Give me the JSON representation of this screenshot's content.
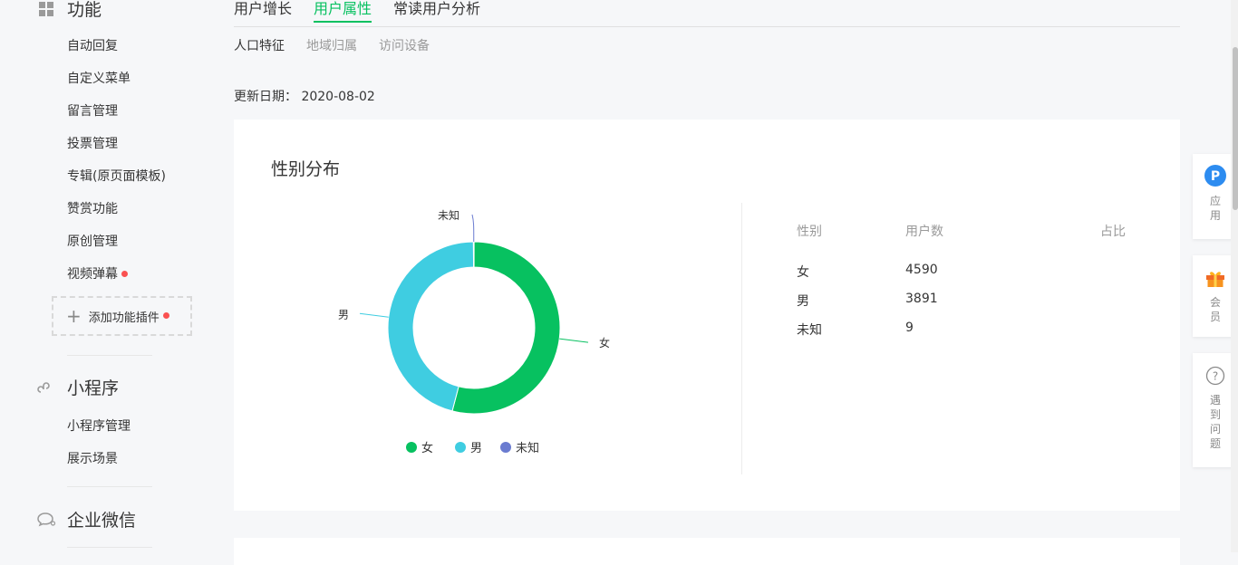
{
  "sidebar": {
    "functions": {
      "title": "功能",
      "items": [
        "自动回复",
        "自定义菜单",
        "留言管理",
        "投票管理",
        "专辑(原页面模板)",
        "赞赏功能",
        "原创管理",
        "视频弹幕"
      ],
      "add_plugin": "添加功能插件"
    },
    "miniprogram": {
      "title": "小程序",
      "items": [
        "小程序管理",
        "展示场景"
      ]
    },
    "wework": {
      "title": "企业微信"
    }
  },
  "tabs": [
    "用户增长",
    "用户属性",
    "常读用户分析"
  ],
  "subtabs": [
    "人口特征",
    "地域归属",
    "访问设备"
  ],
  "update": {
    "label": "更新日期：",
    "date": "2020-08-02"
  },
  "card": {
    "title": "性别分布",
    "table": {
      "headers": [
        "性别",
        "用户数",
        "占比"
      ],
      "rows": [
        {
          "gender": "女",
          "count": "4590",
          "ratio": ""
        },
        {
          "gender": "男",
          "count": "3891",
          "ratio": ""
        },
        {
          "gender": "未知",
          "count": "9",
          "ratio": ""
        }
      ]
    }
  },
  "chart_data": {
    "type": "pie",
    "style": "donut",
    "categories": [
      "女",
      "男",
      "未知"
    ],
    "values": [
      4590,
      3891,
      9
    ],
    "colors": [
      "#07c160",
      "#3fcde1",
      "#6a7bd0"
    ],
    "legend": "bottom"
  },
  "float": {
    "apps": {
      "text": "应用",
      "icon": "p-icon"
    },
    "member": {
      "text": "会员",
      "icon": "gift-icon"
    },
    "help": {
      "text": "遇到问题",
      "icon": "question-icon"
    }
  }
}
